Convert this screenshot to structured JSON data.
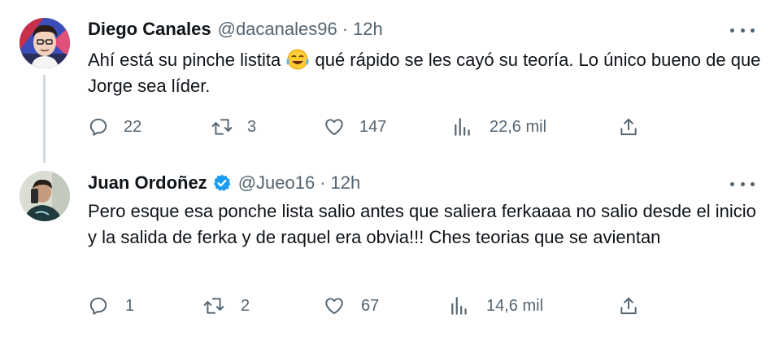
{
  "tweets": [
    {
      "name": "Diego Canales",
      "handle": "@dacanales96",
      "separator": "·",
      "time": "12h",
      "verified": false,
      "text_before_emoji": "Ahí está su pinche listita ",
      "emoji": "face-with-tears-of-joy-emoji",
      "text_after_emoji": " qué rápido se les cayó su teoría. Lo único bueno de que Jorge sea líder.",
      "replies": "22",
      "retweets": "3",
      "likes": "147",
      "views": "22,6 mil"
    },
    {
      "name": "Juan Ordoñez",
      "handle": "@Jueo16",
      "separator": "·",
      "time": "12h",
      "verified": true,
      "text": "Pero esque esa ponche lista salio antes que saliera ferkaaaa no salio desde el inicio y la salida de ferka y de raquel era obvia!!! Ches teorias que se avientan",
      "replies": "1",
      "retweets": "2",
      "likes": "67",
      "views": "14,6 mil"
    }
  ],
  "colors": {
    "text": "#0f1419",
    "secondary": "#536471",
    "verified": "#1d9bf0",
    "thread_line": "#cfd9de"
  }
}
